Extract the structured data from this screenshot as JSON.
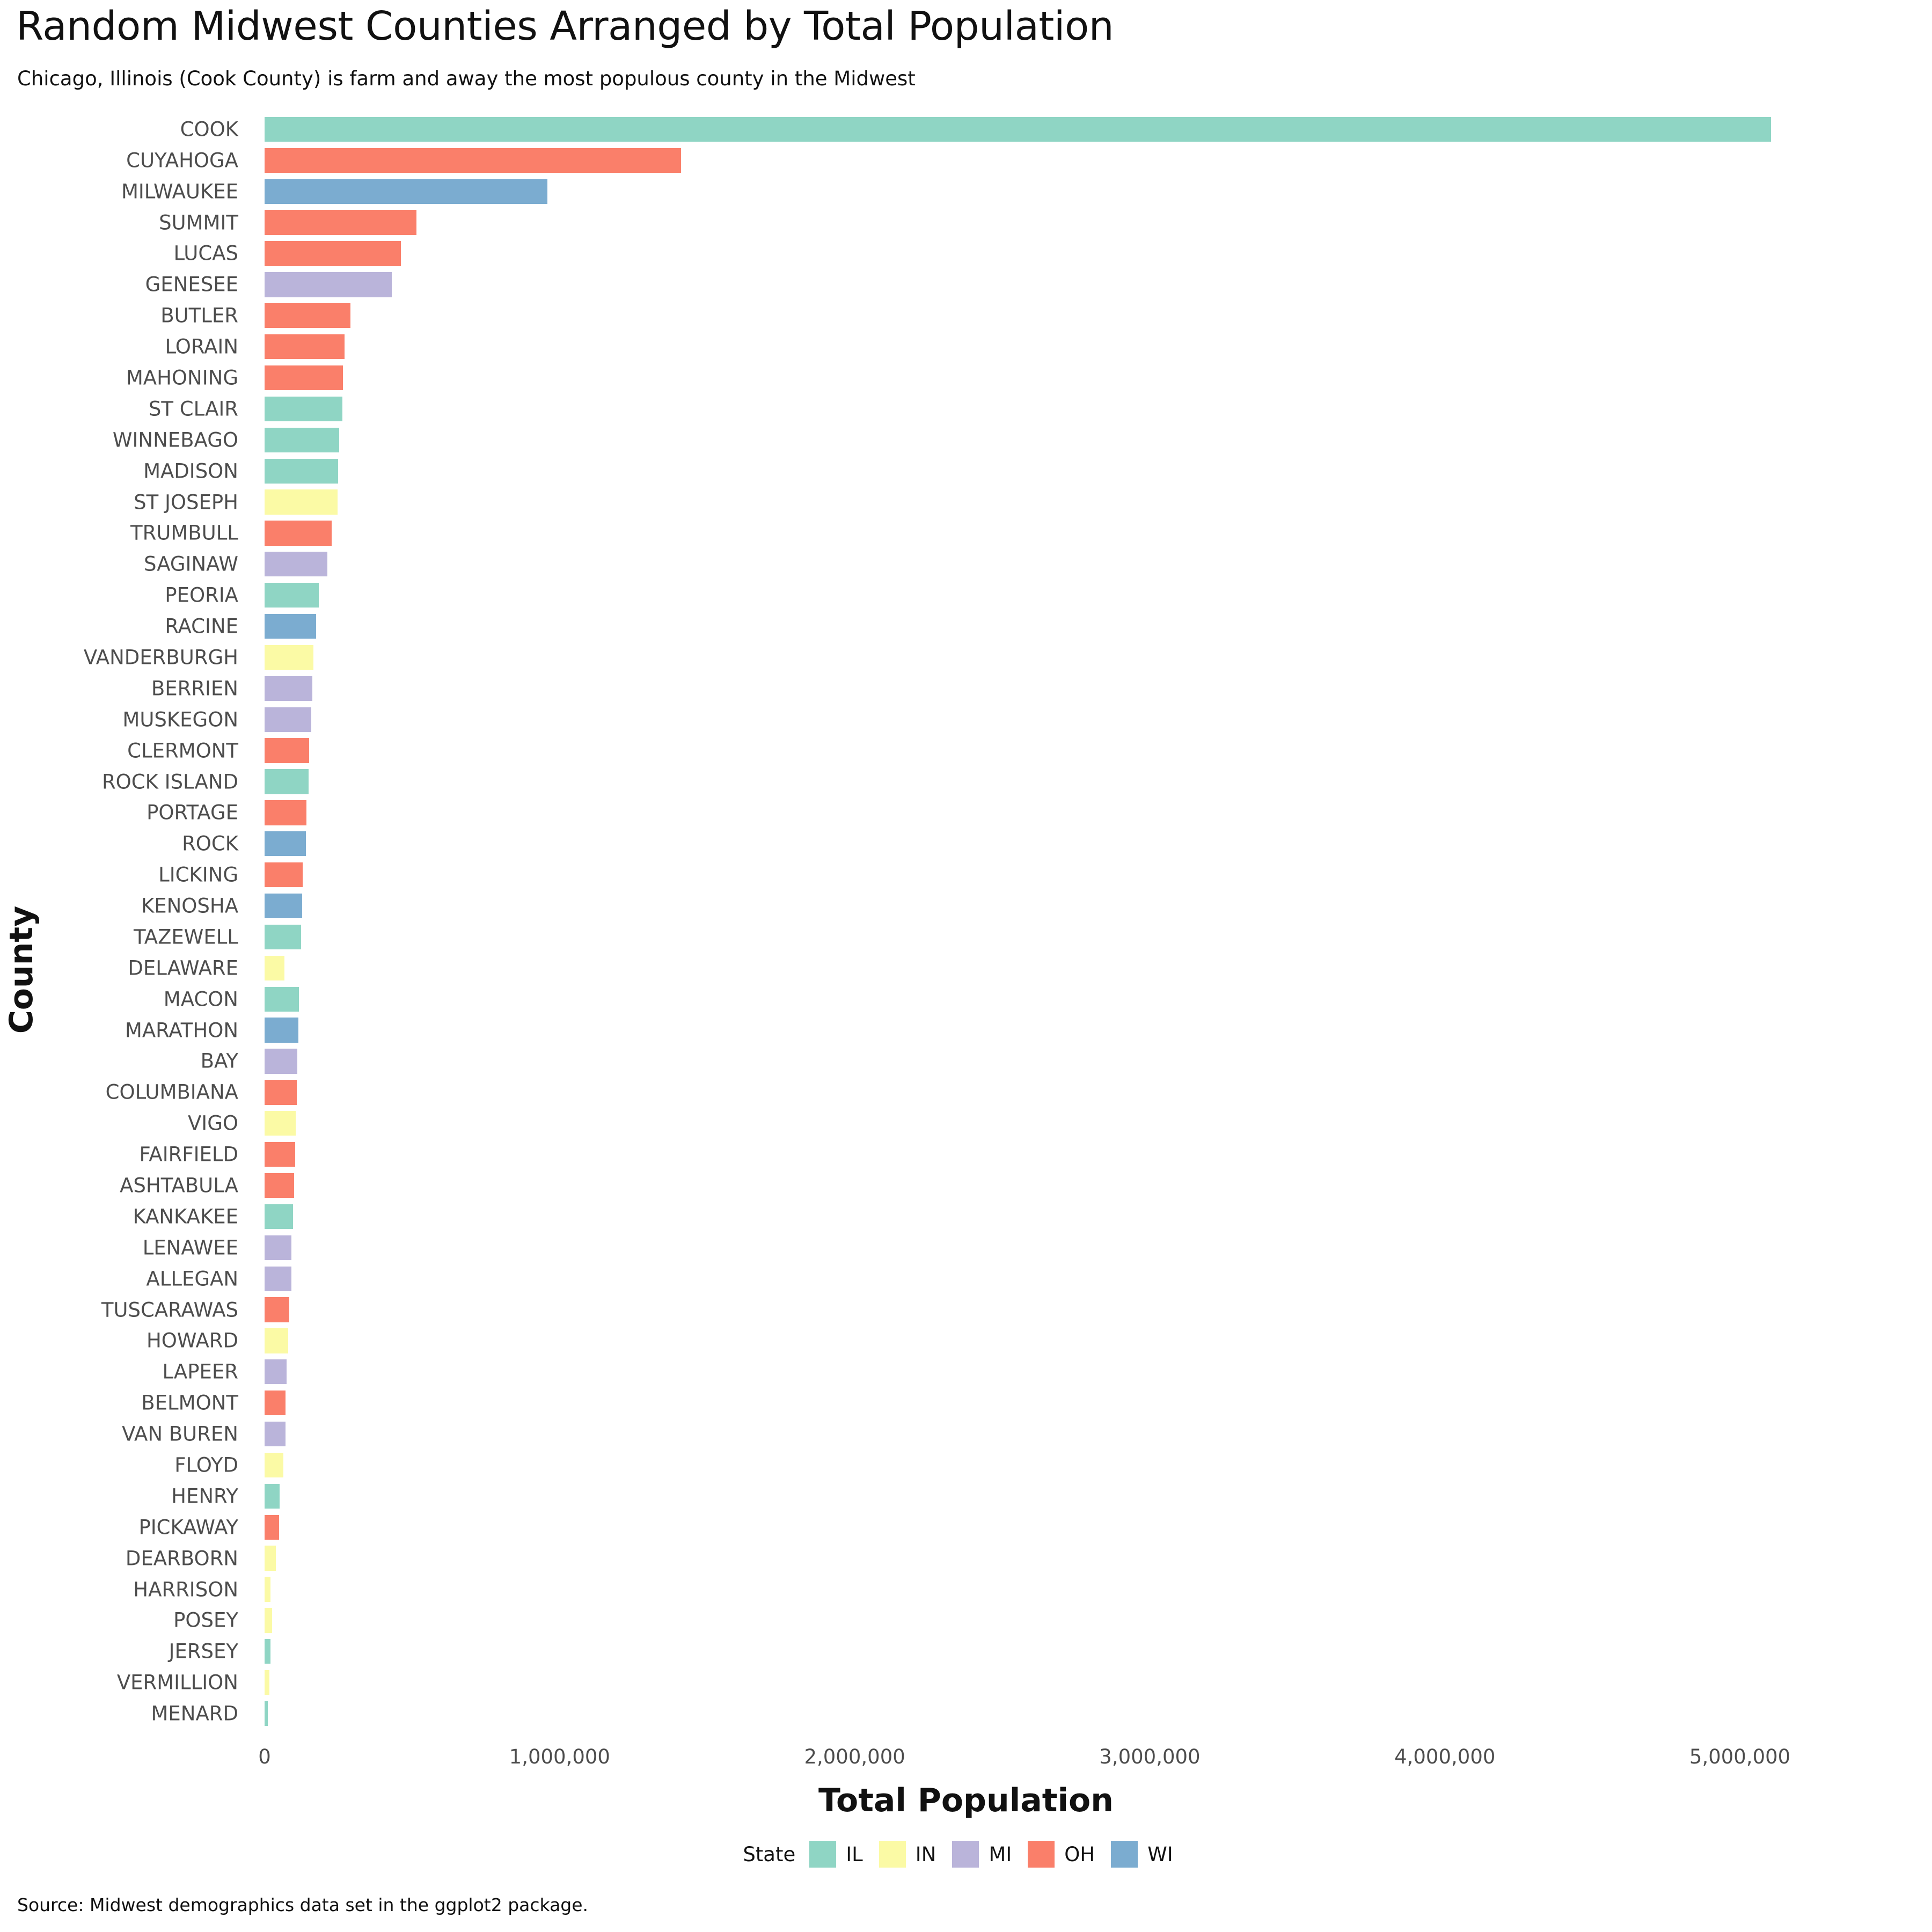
{
  "title": "Random Midwest Counties Arranged by Total Population",
  "subtitle": "Chicago, Illinois (Cook County) is farm and away the most populous county in the Midwest",
  "caption": "Source: Midwest demographics data set in the ggplot2 package.",
  "axes": {
    "x_title": "Total Population",
    "y_title": "County",
    "x_ticks": [
      "0",
      "1,000,000",
      "2,000,000",
      "3,000,000",
      "4,000,000",
      "5,000,000"
    ],
    "x_tick_values": [
      0,
      1000000,
      2000000,
      3000000,
      4000000,
      5000000
    ]
  },
  "legend": {
    "title": "State",
    "items": [
      {
        "label": "IL",
        "color": "#8fd5c4"
      },
      {
        "label": "IN",
        "color": "#fbfaa5"
      },
      {
        "label": "MI",
        "color": "#bab4da"
      },
      {
        "label": "OH",
        "color": "#fa7f6a"
      },
      {
        "label": "WI",
        "color": "#7bacd0"
      }
    ]
  },
  "palette": {
    "IL": "#8fd5c4",
    "IN": "#fbfaa5",
    "MI": "#bab4da",
    "OH": "#fa7f6a",
    "WI": "#7bacd0"
  },
  "chart_data": {
    "type": "bar",
    "orientation": "horizontal",
    "title": "Random Midwest Counties Arranged by Total Population",
    "subtitle": "Chicago, Illinois (Cook County) is farm and away the most populous county in the Midwest",
    "xlabel": "Total Population",
    "ylabel": "County",
    "xlim": [
      0,
      5420000
    ],
    "grid": false,
    "legend_position": "bottom",
    "legend_title": "State",
    "categories": [
      "COOK",
      "CUYAHOGA",
      "MILWAUKEE",
      "SUMMIT",
      "LUCAS",
      "GENESEE",
      "BUTLER",
      "LORAIN",
      "MAHONING",
      "ST CLAIR",
      "WINNEBAGO",
      "MADISON",
      "ST JOSEPH",
      "TRUMBULL",
      "SAGINAW",
      "PEORIA",
      "RACINE",
      "VANDERBURGH",
      "BERRIEN",
      "MUSKEGON",
      "CLERMONT",
      "ROCK ISLAND",
      "PORTAGE",
      "ROCK",
      "LICKING",
      "KENOSHA",
      "TAZEWELL",
      "DELAWARE",
      "MACON",
      "MARATHON",
      "BAY",
      "COLUMBIANA",
      "VIGO",
      "FAIRFIELD",
      "ASHTABULA",
      "KANKAKEE",
      "LENAWEE",
      "ALLEGAN",
      "TUSCARAWAS",
      "HOWARD",
      "LAPEER",
      "BELMONT",
      "VAN BUREN",
      "FLOYD",
      "HENRY",
      "PICKAWAY",
      "DEARBORN",
      "HARRISON",
      "POSEY",
      "JERSEY",
      "VERMILLION",
      "MENARD"
    ],
    "values": [
      5105067,
      1412140,
      959275,
      514990,
      462361,
      430459,
      291479,
      271126,
      264806,
      262852,
      252913,
      249238,
      247052,
      227813,
      211946,
      182827,
      175034,
      165058,
      161378,
      158983,
      150187,
      148723,
      142585,
      139510,
      128300,
      128181,
      123692,
      66929,
      117206,
      115400,
      111723,
      108276,
      106107,
      103461,
      99821,
      96255,
      91476,
      90509,
      84090,
      80827,
      74768,
      71074,
      70060,
      64404,
      51159,
      48255,
      38315,
      19913,
      25968,
      20539,
      16773,
      11164
    ],
    "bar_colors": [
      "IL",
      "OH",
      "WI",
      "OH",
      "OH",
      "MI",
      "OH",
      "OH",
      "OH",
      "IL",
      "IL",
      "IL",
      "IN",
      "OH",
      "MI",
      "IL",
      "WI",
      "IN",
      "MI",
      "MI",
      "OH",
      "IL",
      "OH",
      "WI",
      "OH",
      "WI",
      "IL",
      "IN",
      "IL",
      "WI",
      "MI",
      "OH",
      "IN",
      "OH",
      "OH",
      "IL",
      "MI",
      "MI",
      "OH",
      "IN",
      "MI",
      "OH",
      "MI",
      "IN",
      "IL",
      "OH",
      "IN",
      "IN",
      "IN",
      "IL",
      "IN",
      "IL"
    ]
  }
}
